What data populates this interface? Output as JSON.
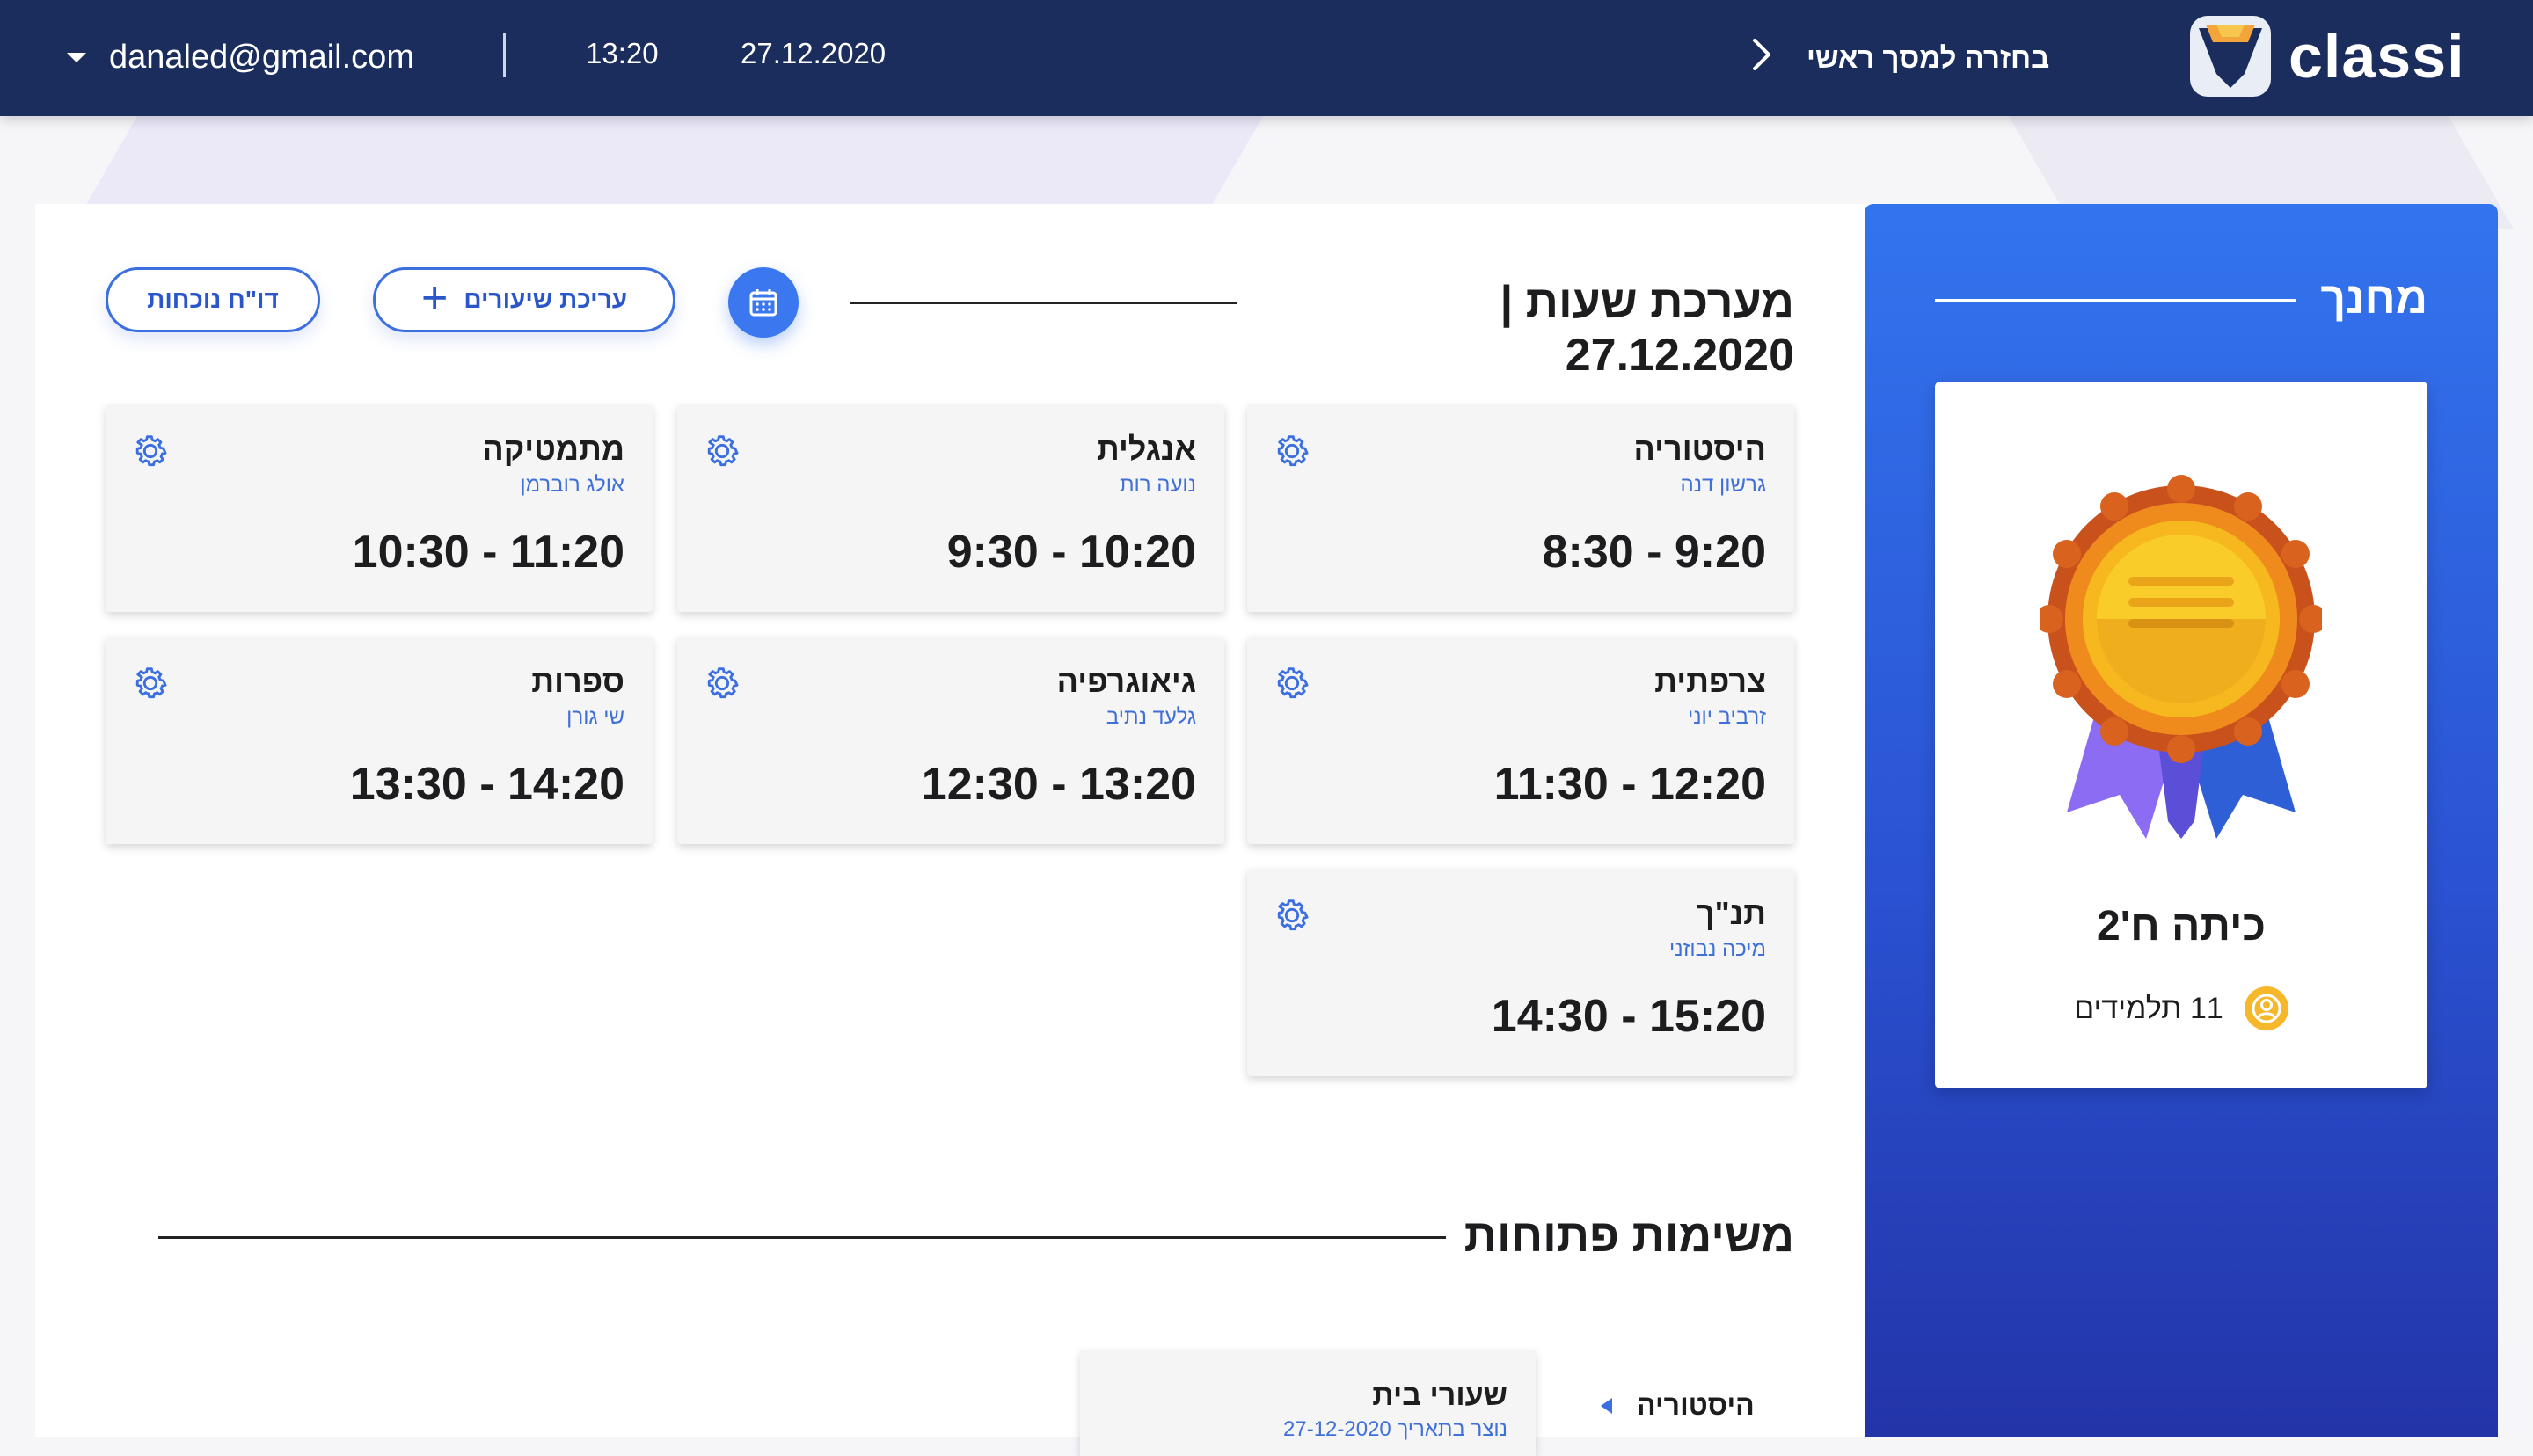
{
  "header": {
    "user_email": "danaled@gmail.com",
    "time": "13:20",
    "date": "27.12.2020",
    "back_label": "בחזרה למסך ראשי",
    "logo_text": "classi"
  },
  "sidebar": {
    "title": "מחנך",
    "class_name": "כיתה ח'2",
    "students_label": "11 תלמידים"
  },
  "schedule": {
    "title": "מערכת שעות | 27.12.2020",
    "edit_label": "עריכת שיעורים",
    "report_label": "דו\"ח נוכחות",
    "lessons": [
      {
        "subject": "היסטוריה",
        "teacher": "גרשון דנה",
        "time": "8:30 - 9:20"
      },
      {
        "subject": "אנגלית",
        "teacher": "נועה רות",
        "time": "9:30 - 10:20"
      },
      {
        "subject": "מתמטיקה",
        "teacher": "אולג רוברמן",
        "time": "10:30 - 11:20"
      },
      {
        "subject": "צרפתית",
        "teacher": "זרביב יוני",
        "time": "11:30 - 12:20"
      },
      {
        "subject": "גיאוגרפיה",
        "teacher": "גלעד נתיב",
        "time": "12:30 - 13:20"
      },
      {
        "subject": "ספרות",
        "teacher": "שי גורן",
        "time": "13:30 - 14:20"
      },
      {
        "subject": "תנ\"ך",
        "teacher": "מיכה נבוזני",
        "time": "14:30 - 15:20"
      }
    ]
  },
  "tasks": {
    "title": "משימות פתוחות",
    "items": [
      {
        "subject": "היסטוריה",
        "title": "שעורי בית",
        "date": "נוצר בתאריך 27-12-2020"
      }
    ]
  },
  "colors": {
    "header_bg": "#1b2d5c",
    "accent": "#3b78f0",
    "sidebar_top": "#3374ee",
    "sidebar_bottom": "#2334a8",
    "student_icon": "#f6b72a"
  },
  "icons": {
    "dropdown": "caret-down-icon",
    "back": "chevron-right-icon",
    "calendar": "calendar-icon",
    "plus": "plus-icon",
    "settings": "gear-icon",
    "students": "user-circle-icon",
    "award": "award-medal-icon",
    "expand": "triangle-left-icon"
  }
}
